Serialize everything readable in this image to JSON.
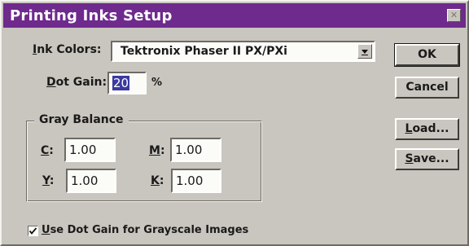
{
  "window": {
    "title": "Printing Inks Setup",
    "close_glyph": "✕"
  },
  "ink_colors": {
    "label_mnemonic": "I",
    "label_rest": "nk Colors:",
    "value": "Tektronix Phaser II PX/PXi"
  },
  "dot_gain": {
    "label_mnemonic": "D",
    "label_rest": "ot Gain:",
    "value": "20",
    "unit": "%"
  },
  "gray_balance": {
    "title": "Gray Balance",
    "c": {
      "mnemonic": "C",
      "rest": ":",
      "value": "1.00"
    },
    "m": {
      "mnemonic": "M",
      "rest": ":",
      "value": "1.00"
    },
    "y": {
      "mnemonic": "Y",
      "rest": ":",
      "value": "1.00"
    },
    "k": {
      "mnemonic": "K",
      "rest": ":",
      "value": "1.00"
    }
  },
  "buttons": {
    "ok": "OK",
    "cancel": "Cancel",
    "load_mnemonic": "L",
    "load_rest": "oad...",
    "save_mnemonic": "S",
    "save_rest": "ave..."
  },
  "checkbox": {
    "checked": true,
    "label_mnemonic": "U",
    "label_rest": "se Dot Gain for Grayscale Images"
  },
  "colors": {
    "titlebar": "#6e2a8c",
    "face": "#c9c6bf",
    "selection": "#3b3aa0"
  }
}
